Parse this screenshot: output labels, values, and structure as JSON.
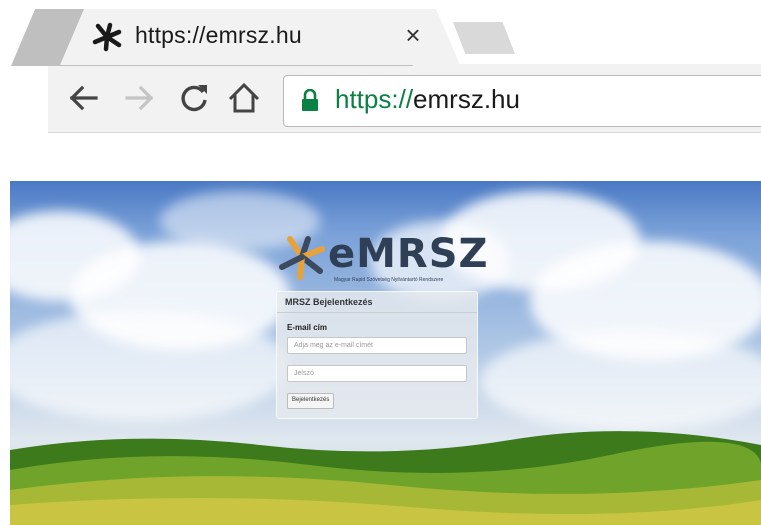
{
  "browser": {
    "tab": {
      "title": "https://emrsz.hu",
      "close_label": "×"
    },
    "toolbar": {
      "back_icon": "arrow-left-icon",
      "forward_icon": "arrow-right-icon",
      "reload_icon": "reload-icon",
      "home_icon": "home-icon"
    },
    "address_bar": {
      "scheme": "https://",
      "host": "emrsz.hu",
      "secure_icon": "lock-icon",
      "secure_color": "#0b8043"
    }
  },
  "page": {
    "logo": {
      "wordmark": "eMRSZ",
      "tagline": "Magyar Rapid Szövetség Nyilvántartó Rendszere",
      "mark_colors": [
        "#3b4a5e",
        "#e8a23c"
      ]
    },
    "login": {
      "title": "MRSZ Bejelentkezés",
      "email_label": "E-mail cím",
      "email_placeholder": "Adja meg az e-mail címét",
      "password_placeholder": "Jelszó",
      "submit_label": "Bejelentkezés"
    }
  }
}
